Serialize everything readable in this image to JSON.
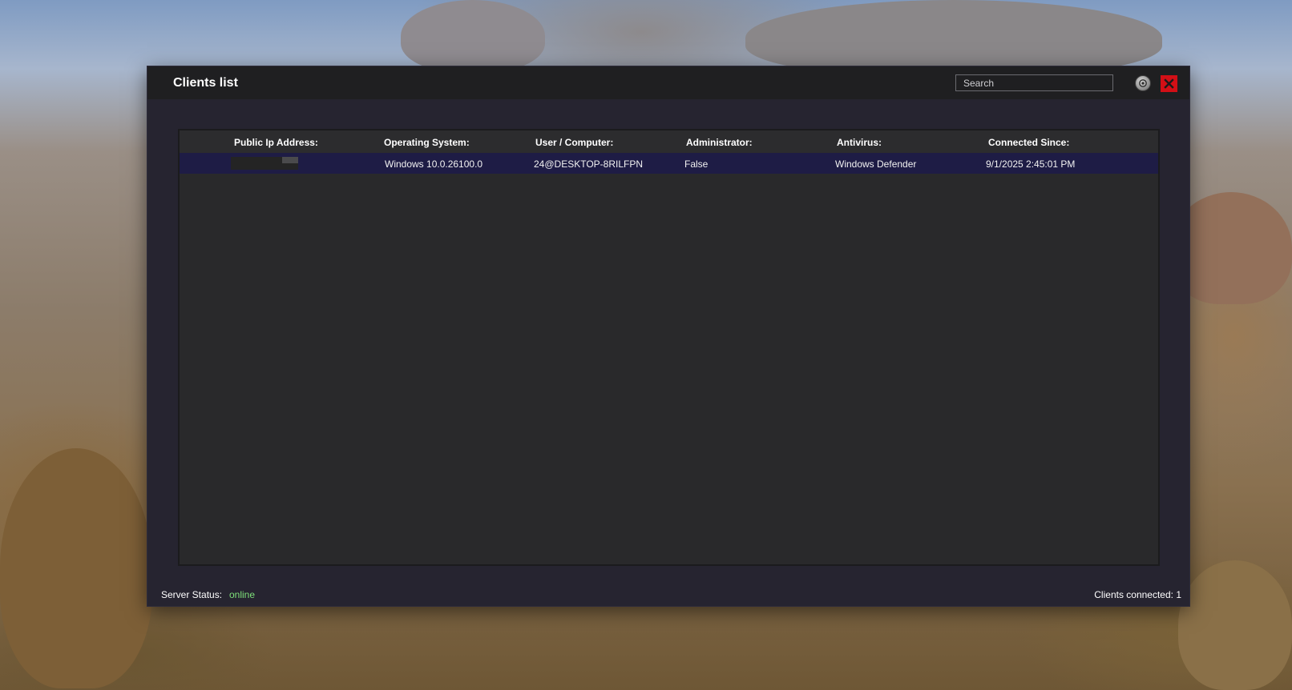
{
  "window": {
    "title": "Clients list",
    "search_placeholder": "Search",
    "settings_icon": "settings-icon",
    "close_icon": "close-icon",
    "close_color": "#d20f16"
  },
  "table": {
    "columns": [
      "Public Ip Address:",
      "Operating System:",
      "User / Computer:",
      "Administrator:",
      "Antivirus:",
      "Connected Since:"
    ],
    "rows": [
      {
        "public_ip": "",
        "operating_system": "Windows  10.0.26100.0",
        "user_computer": "24@DESKTOP-8RILFPN",
        "administrator": "False",
        "antivirus": "Windows Defender",
        "connected_since": "9/1/2025 2:45:01 PM"
      }
    ],
    "selected_row_color": "#1e1c45"
  },
  "status_bar": {
    "server_status_label": "Server Status:",
    "server_status_value": "online",
    "server_status_color": "#7ee07a",
    "clients_connected": "Clients connected: 1"
  }
}
